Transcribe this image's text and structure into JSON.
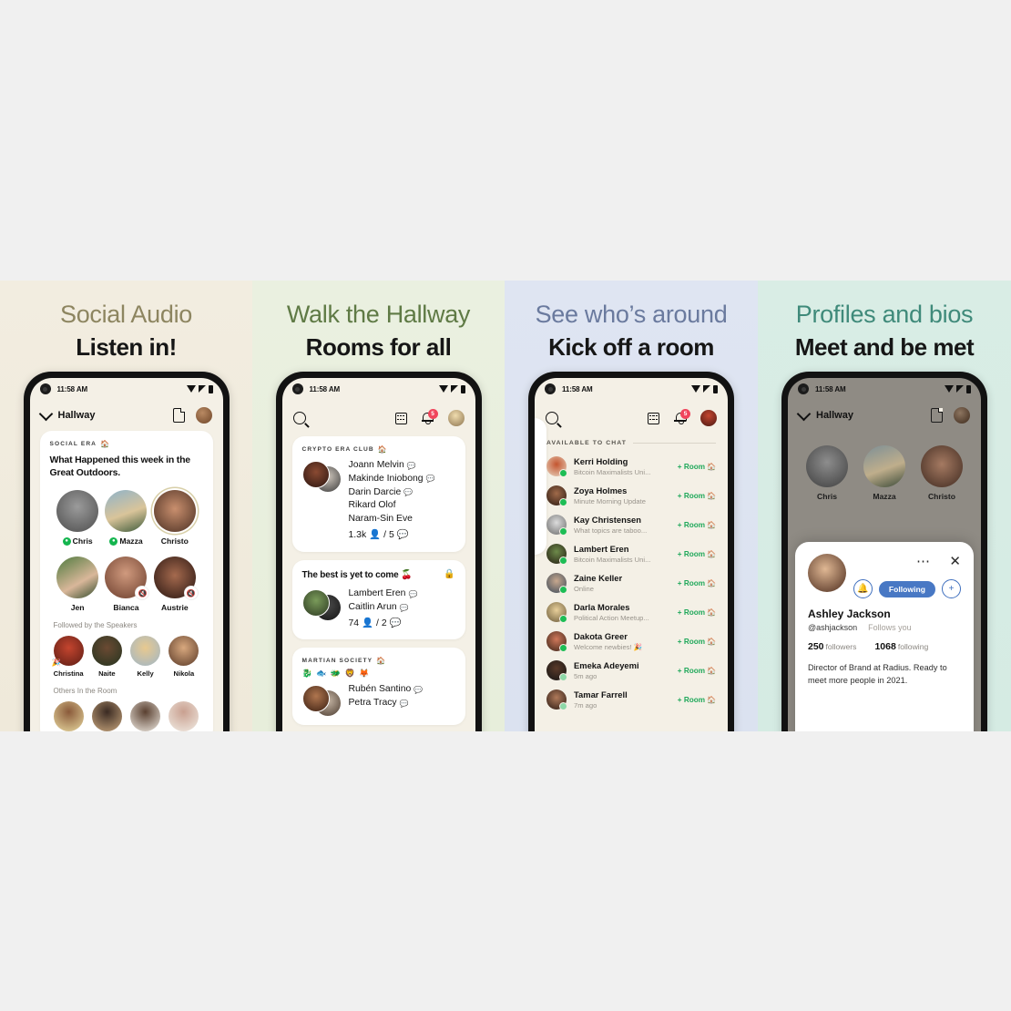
{
  "page": {
    "background": "#f0f0f0"
  },
  "panels": [
    {
      "kicker": "Social Audio",
      "headline": "Listen in!",
      "kicker_color": "#8d8560",
      "bg": "#f2ede0",
      "status": {
        "time": "11:58 AM"
      },
      "appbar": {
        "title": "Hallway",
        "doc_icon": "document-icon",
        "avatar": "avatar-icon"
      },
      "card": {
        "club": "SOCIAL ERA",
        "club_icon": "house-icon",
        "title": "What Happened this week in the Great Outdoors.",
        "speakers": [
          {
            "name": "Chris",
            "mic": "on"
          },
          {
            "name": "Mazza",
            "mic": "on"
          },
          {
            "name": "Christo",
            "mic": "none",
            "ring": true
          },
          {
            "name": "Jen",
            "mic": "none"
          },
          {
            "name": "Bianca",
            "mic": "muted"
          },
          {
            "name": "Austrie",
            "mic": "muted"
          }
        ],
        "followed_label": "Followed by the Speakers",
        "followed": [
          "Christina",
          "Naite",
          "Kelly",
          "Nikola"
        ],
        "others_label": "Others In the Room"
      }
    },
    {
      "kicker": "Walk the Hallway",
      "headline": "Rooms for all",
      "kicker_color": "#5f7a45",
      "bg": "#eaf0e0",
      "status": {
        "time": "11:58 AM"
      },
      "appbar": {
        "search_icon": "search-icon",
        "calendar_icon": "calendar-icon",
        "bell_icon": "bell-icon",
        "bell_badge": "5",
        "avatar": "avatar-icon"
      },
      "rooms": [
        {
          "club": "CRYPTO ERA CLUB",
          "club_icon": "house-icon",
          "members": [
            "Joann Melvin",
            "Makinde Iniobong",
            "Darin Darcie",
            "Rikard Olof",
            "Naram-Sin Eve"
          ],
          "bubbles": [
            true,
            true,
            true,
            false,
            false
          ],
          "listeners": "1.3k",
          "speakers": "5",
          "locked": false
        },
        {
          "title": "The best is yet to come 🍒",
          "members": [
            "Lambert Eren",
            "Caitlin Arun"
          ],
          "bubbles": [
            true,
            true
          ],
          "listeners": "74",
          "speakers": "2",
          "locked": true
        },
        {
          "club": "MARTIAN SOCIETY",
          "club_icon": "house-icon",
          "emojis": "🐉 🐟 🐲 🦁 🦊",
          "members": [
            "Rubén Santino",
            "Petra Tracy"
          ],
          "bubbles": [
            true,
            true
          ],
          "locked": false
        }
      ]
    },
    {
      "kicker": "See who’s around",
      "headline": "Kick off a room",
      "kicker_color": "#6a7a9e",
      "bg": "#dfe5f2",
      "status": {
        "time": "11:58 AM"
      },
      "appbar": {
        "search_icon": "search-icon",
        "calendar_icon": "calendar-icon",
        "bell_icon": "bell-icon",
        "bell_badge": "5",
        "avatar": "avatar-icon"
      },
      "available": {
        "section_label": "AVAILABLE TO CHAT",
        "room_button_label": "+ Room",
        "people": [
          {
            "name": "Kerri Holding",
            "status": "Bitcoin Maximalists Uni...",
            "online": "full"
          },
          {
            "name": "Zoya Holmes",
            "status": "Minute Morning Update",
            "online": "full"
          },
          {
            "name": "Kay Christensen",
            "status": "What topics are taboo...",
            "online": "full"
          },
          {
            "name": "Lambert Eren",
            "status": "Bitcoin Maximalists Uni...",
            "online": "full"
          },
          {
            "name": "Zaine Keller",
            "status": "Online",
            "online": "full"
          },
          {
            "name": "Darla Morales",
            "status": "Political Action Meetup...",
            "online": "full"
          },
          {
            "name": "Dakota Greer",
            "status": "Welcome newbies! 🎉",
            "online": "full"
          },
          {
            "name": "Emeka Adeyemi",
            "status": "5m ago",
            "online": "pale"
          },
          {
            "name": "Tamar Farrell",
            "status": "7m ago",
            "online": "pale"
          }
        ]
      }
    },
    {
      "kicker": "Profiles and bios",
      "headline": "Meet and be met",
      "kicker_color": "#3f8a7a",
      "bg": "#d9ede5",
      "status": {
        "time": "11:58 AM"
      },
      "appbar": {
        "title": "Hallway",
        "doc_icon": "document-icon",
        "avatar": "avatar-icon"
      },
      "background_speakers": [
        "Chris",
        "Mazza",
        "Christo"
      ],
      "profile": {
        "more_icon": "more-dots-icon",
        "close_icon": "close-icon",
        "bell_icon": "bell-icon",
        "follow_label": "Following",
        "add_icon": "add-person-icon",
        "name": "Ashley Jackson",
        "handle": "@ashjackson",
        "follows_you": "Follows you",
        "followers_count": "250",
        "followers_label": "followers",
        "following_count": "1068",
        "following_label": "following",
        "bio": "Director of Brand at Radius. Ready to meet more people in 2021."
      }
    }
  ]
}
